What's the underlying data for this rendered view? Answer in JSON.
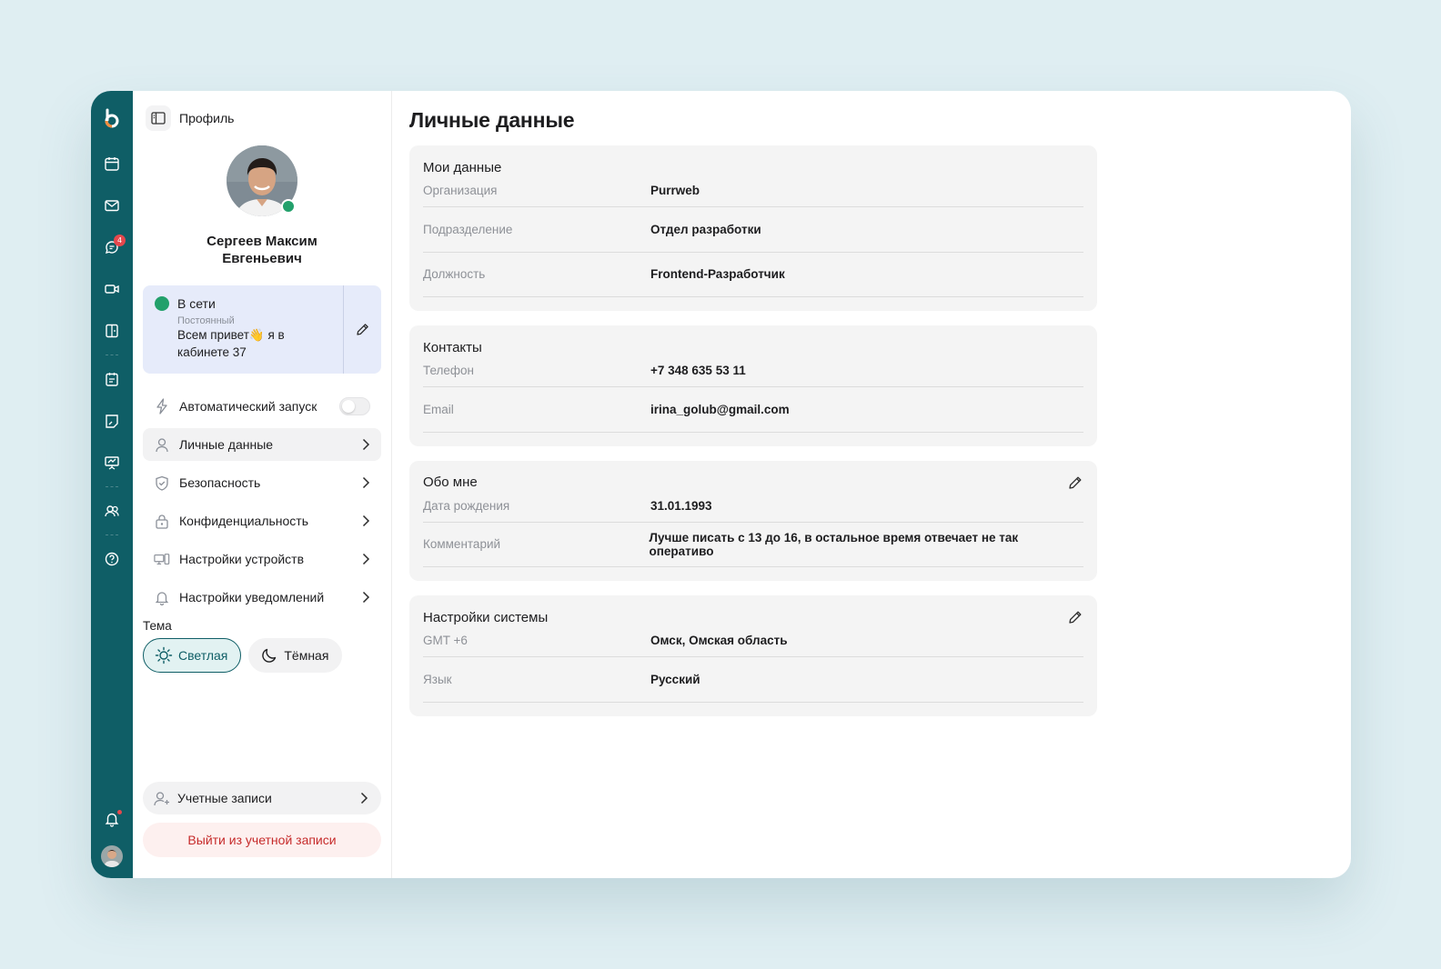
{
  "profile_panel": {
    "title": "Профиль",
    "user_name": "Сергеев Максим Евгеньевич",
    "status": {
      "label": "В сети",
      "type": "Постоянный",
      "message": "Всем привет👋 я в кабинете 37"
    },
    "menu": [
      {
        "label": "Автоматический запуск",
        "icon": "bolt-icon",
        "kind": "toggle",
        "value": false
      },
      {
        "label": "Личные данные",
        "icon": "user-icon",
        "kind": "link",
        "active": true
      },
      {
        "label": "Безопасность",
        "icon": "shield-icon",
        "kind": "link"
      },
      {
        "label": "Конфиденциальность",
        "icon": "lock-icon",
        "kind": "link"
      },
      {
        "label": "Настройки устройств",
        "icon": "devices-icon",
        "kind": "link"
      },
      {
        "label": "Настройки уведомлений",
        "icon": "bell-icon",
        "kind": "link"
      }
    ],
    "theme": {
      "label": "Тема",
      "light": "Светлая",
      "dark": "Тёмная",
      "selected": "light"
    },
    "accounts_label": "Учетные записи",
    "logout_label": "Выйти из учетной записи"
  },
  "rail": {
    "icons": [
      "logo",
      "calendar-icon",
      "mail-icon",
      "chat-icon",
      "video-icon",
      "document-icon",
      "task-icon",
      "notes-icon",
      "presentation-icon",
      "contacts-icon",
      "help-icon",
      "bell-icon"
    ],
    "chat_badge": "4"
  },
  "main": {
    "title": "Личные данные",
    "sections": [
      {
        "title": "Мои данные",
        "editable": false,
        "rows": [
          {
            "label": "Организация",
            "value": "Purrweb"
          },
          {
            "label": "Подразделение",
            "value": "Отдел разработки"
          },
          {
            "label": "Должность",
            "value": "Frontend-Разработчик"
          }
        ]
      },
      {
        "title": "Контакты",
        "editable": false,
        "rows": [
          {
            "label": "Телефон",
            "value": "+7 348 635 53 11"
          },
          {
            "label": "Email",
            "value": "irina_golub@gmail.com"
          }
        ]
      },
      {
        "title": "Обо мне",
        "editable": true,
        "rows": [
          {
            "label": "Дата рождения",
            "value": "31.01.1993"
          },
          {
            "label": "Комментарий",
            "value": "Лучше писать с 13 до 16, в остальное время отвечает не так оперативо"
          }
        ]
      },
      {
        "title": "Настройки системы",
        "editable": true,
        "rows": [
          {
            "label": "GMT +6",
            "value": "Омск, Омская область"
          },
          {
            "label": "Язык",
            "value": "Русский"
          }
        ]
      }
    ]
  },
  "colors": {
    "rail": "#0f5e66",
    "accent": "#0f5e66",
    "online": "#22a06b",
    "badge": "#e5484d",
    "status_card": "#e6ebfa",
    "logout_text": "#c62b2b",
    "logout_bg": "#fdf0ef"
  }
}
